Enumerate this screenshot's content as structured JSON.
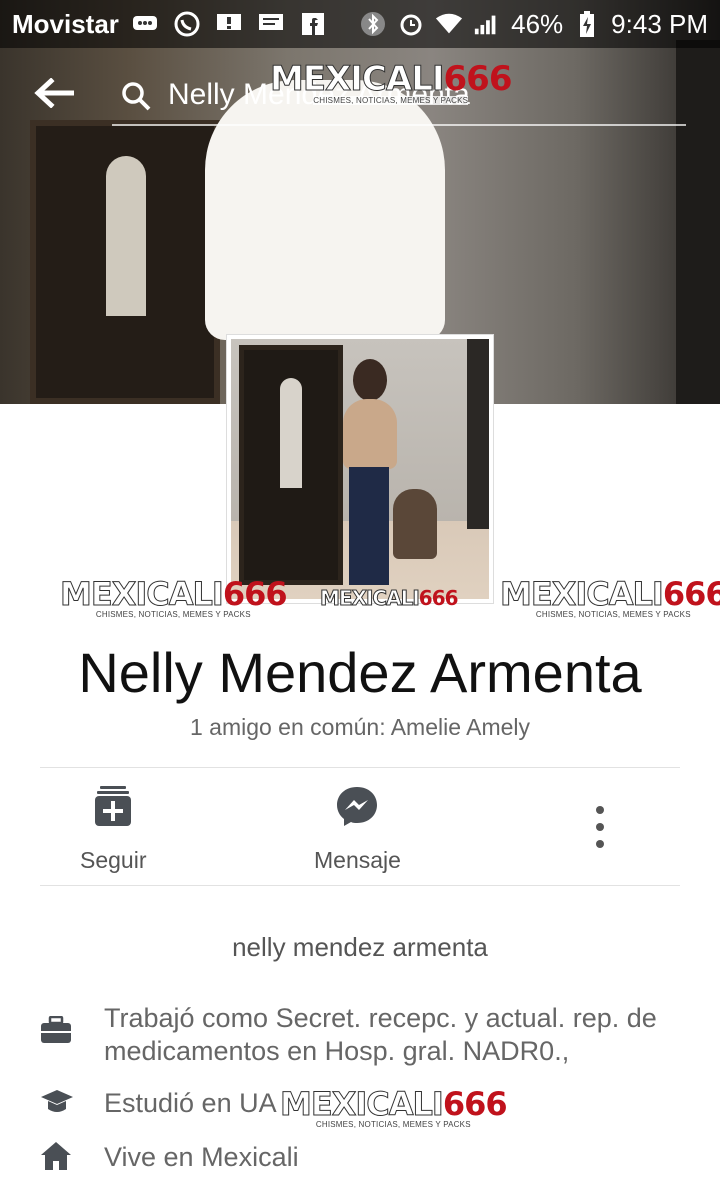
{
  "status_bar": {
    "carrier": "Movistar",
    "battery": "46%",
    "time": "9:43 PM"
  },
  "search": {
    "query": "Nelly Mendez Armenta"
  },
  "profile": {
    "name": "Nelly Mendez Armenta",
    "mutual_friends": "1 amigo en común: Amelie Amely"
  },
  "actions": {
    "follow_label": "Seguir",
    "message_label": "Mensaje"
  },
  "about": {
    "intro_name": "nelly mendez armenta",
    "work": "Trabajó como Secret. recepc. y actual. rep. de medicamentos en Hosp. gral. NADR0.,",
    "education": "Estudió en UA",
    "lives": "Vive en Mexicali"
  },
  "watermark": {
    "brand_white": "MEXICALI",
    "brand_red": "666",
    "tagline": "CHISMES, NOTICIAS, MEMES Y PACKS"
  },
  "colors": {
    "watermark_red": "#c0121c",
    "icon_gray": "#4a4f55",
    "text_dark": "#111111",
    "text_gray": "#666666"
  }
}
